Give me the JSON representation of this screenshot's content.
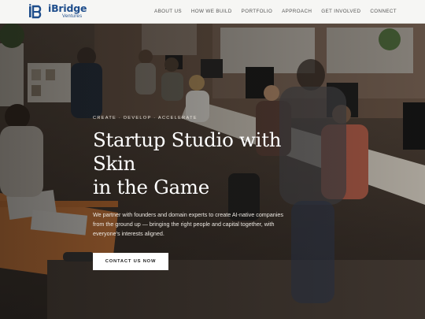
{
  "brand": {
    "name": "iBridge",
    "sub": "Ventures",
    "color": "#1f4e8c"
  },
  "nav": {
    "items": [
      {
        "label": "ABOUT US"
      },
      {
        "label": "HOW WE BUILD"
      },
      {
        "label": "PORTFOLIO"
      },
      {
        "label": "APPROACH"
      },
      {
        "label": "GET INVOLVED"
      },
      {
        "label": "CONNECT"
      }
    ]
  },
  "hero": {
    "eyebrow": "CREATE · DEVELOP · ACCELERATE",
    "headline_line1": "Startup Studio with Skin",
    "headline_line2": "in the Game",
    "subhead": "We partner with founders and domain experts to create AI-native companies from the ground up — bringing the right people and capital together, with everyone's interests aligned.",
    "cta_label": "CONTACT US NOW",
    "background_image": "office-coworking-photo"
  }
}
